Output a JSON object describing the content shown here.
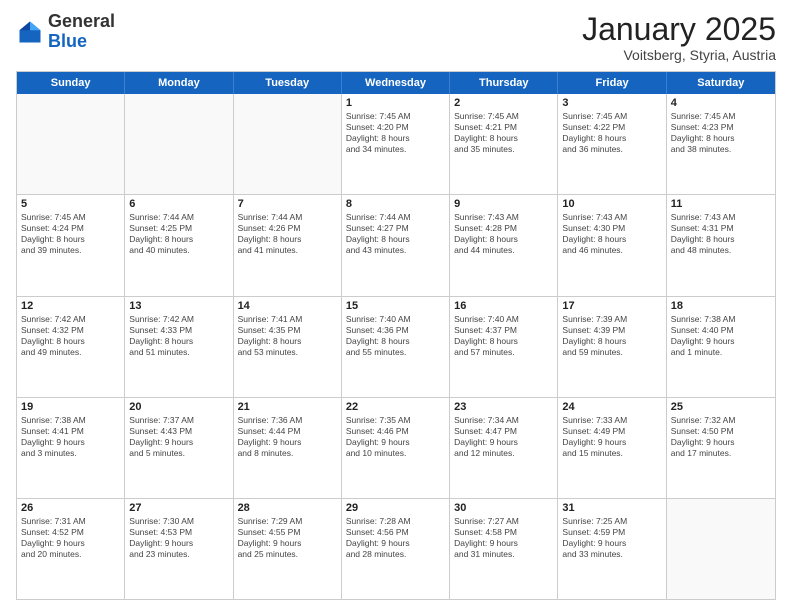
{
  "header": {
    "logo_general": "General",
    "logo_blue": "Blue",
    "title": "January 2025",
    "subtitle": "Voitsberg, Styria, Austria"
  },
  "days": [
    "Sunday",
    "Monday",
    "Tuesday",
    "Wednesday",
    "Thursday",
    "Friday",
    "Saturday"
  ],
  "weeks": [
    [
      {
        "day": "",
        "lines": []
      },
      {
        "day": "",
        "lines": []
      },
      {
        "day": "",
        "lines": []
      },
      {
        "day": "1",
        "lines": [
          "Sunrise: 7:45 AM",
          "Sunset: 4:20 PM",
          "Daylight: 8 hours",
          "and 34 minutes."
        ]
      },
      {
        "day": "2",
        "lines": [
          "Sunrise: 7:45 AM",
          "Sunset: 4:21 PM",
          "Daylight: 8 hours",
          "and 35 minutes."
        ]
      },
      {
        "day": "3",
        "lines": [
          "Sunrise: 7:45 AM",
          "Sunset: 4:22 PM",
          "Daylight: 8 hours",
          "and 36 minutes."
        ]
      },
      {
        "day": "4",
        "lines": [
          "Sunrise: 7:45 AM",
          "Sunset: 4:23 PM",
          "Daylight: 8 hours",
          "and 38 minutes."
        ]
      }
    ],
    [
      {
        "day": "5",
        "lines": [
          "Sunrise: 7:45 AM",
          "Sunset: 4:24 PM",
          "Daylight: 8 hours",
          "and 39 minutes."
        ]
      },
      {
        "day": "6",
        "lines": [
          "Sunrise: 7:44 AM",
          "Sunset: 4:25 PM",
          "Daylight: 8 hours",
          "and 40 minutes."
        ]
      },
      {
        "day": "7",
        "lines": [
          "Sunrise: 7:44 AM",
          "Sunset: 4:26 PM",
          "Daylight: 8 hours",
          "and 41 minutes."
        ]
      },
      {
        "day": "8",
        "lines": [
          "Sunrise: 7:44 AM",
          "Sunset: 4:27 PM",
          "Daylight: 8 hours",
          "and 43 minutes."
        ]
      },
      {
        "day": "9",
        "lines": [
          "Sunrise: 7:43 AM",
          "Sunset: 4:28 PM",
          "Daylight: 8 hours",
          "and 44 minutes."
        ]
      },
      {
        "day": "10",
        "lines": [
          "Sunrise: 7:43 AM",
          "Sunset: 4:30 PM",
          "Daylight: 8 hours",
          "and 46 minutes."
        ]
      },
      {
        "day": "11",
        "lines": [
          "Sunrise: 7:43 AM",
          "Sunset: 4:31 PM",
          "Daylight: 8 hours",
          "and 48 minutes."
        ]
      }
    ],
    [
      {
        "day": "12",
        "lines": [
          "Sunrise: 7:42 AM",
          "Sunset: 4:32 PM",
          "Daylight: 8 hours",
          "and 49 minutes."
        ]
      },
      {
        "day": "13",
        "lines": [
          "Sunrise: 7:42 AM",
          "Sunset: 4:33 PM",
          "Daylight: 8 hours",
          "and 51 minutes."
        ]
      },
      {
        "day": "14",
        "lines": [
          "Sunrise: 7:41 AM",
          "Sunset: 4:35 PM",
          "Daylight: 8 hours",
          "and 53 minutes."
        ]
      },
      {
        "day": "15",
        "lines": [
          "Sunrise: 7:40 AM",
          "Sunset: 4:36 PM",
          "Daylight: 8 hours",
          "and 55 minutes."
        ]
      },
      {
        "day": "16",
        "lines": [
          "Sunrise: 7:40 AM",
          "Sunset: 4:37 PM",
          "Daylight: 8 hours",
          "and 57 minutes."
        ]
      },
      {
        "day": "17",
        "lines": [
          "Sunrise: 7:39 AM",
          "Sunset: 4:39 PM",
          "Daylight: 8 hours",
          "and 59 minutes."
        ]
      },
      {
        "day": "18",
        "lines": [
          "Sunrise: 7:38 AM",
          "Sunset: 4:40 PM",
          "Daylight: 9 hours",
          "and 1 minute."
        ]
      }
    ],
    [
      {
        "day": "19",
        "lines": [
          "Sunrise: 7:38 AM",
          "Sunset: 4:41 PM",
          "Daylight: 9 hours",
          "and 3 minutes."
        ]
      },
      {
        "day": "20",
        "lines": [
          "Sunrise: 7:37 AM",
          "Sunset: 4:43 PM",
          "Daylight: 9 hours",
          "and 5 minutes."
        ]
      },
      {
        "day": "21",
        "lines": [
          "Sunrise: 7:36 AM",
          "Sunset: 4:44 PM",
          "Daylight: 9 hours",
          "and 8 minutes."
        ]
      },
      {
        "day": "22",
        "lines": [
          "Sunrise: 7:35 AM",
          "Sunset: 4:46 PM",
          "Daylight: 9 hours",
          "and 10 minutes."
        ]
      },
      {
        "day": "23",
        "lines": [
          "Sunrise: 7:34 AM",
          "Sunset: 4:47 PM",
          "Daylight: 9 hours",
          "and 12 minutes."
        ]
      },
      {
        "day": "24",
        "lines": [
          "Sunrise: 7:33 AM",
          "Sunset: 4:49 PM",
          "Daylight: 9 hours",
          "and 15 minutes."
        ]
      },
      {
        "day": "25",
        "lines": [
          "Sunrise: 7:32 AM",
          "Sunset: 4:50 PM",
          "Daylight: 9 hours",
          "and 17 minutes."
        ]
      }
    ],
    [
      {
        "day": "26",
        "lines": [
          "Sunrise: 7:31 AM",
          "Sunset: 4:52 PM",
          "Daylight: 9 hours",
          "and 20 minutes."
        ]
      },
      {
        "day": "27",
        "lines": [
          "Sunrise: 7:30 AM",
          "Sunset: 4:53 PM",
          "Daylight: 9 hours",
          "and 23 minutes."
        ]
      },
      {
        "day": "28",
        "lines": [
          "Sunrise: 7:29 AM",
          "Sunset: 4:55 PM",
          "Daylight: 9 hours",
          "and 25 minutes."
        ]
      },
      {
        "day": "29",
        "lines": [
          "Sunrise: 7:28 AM",
          "Sunset: 4:56 PM",
          "Daylight: 9 hours",
          "and 28 minutes."
        ]
      },
      {
        "day": "30",
        "lines": [
          "Sunrise: 7:27 AM",
          "Sunset: 4:58 PM",
          "Daylight: 9 hours",
          "and 31 minutes."
        ]
      },
      {
        "day": "31",
        "lines": [
          "Sunrise: 7:25 AM",
          "Sunset: 4:59 PM",
          "Daylight: 9 hours",
          "and 33 minutes."
        ]
      },
      {
        "day": "",
        "lines": []
      }
    ]
  ]
}
